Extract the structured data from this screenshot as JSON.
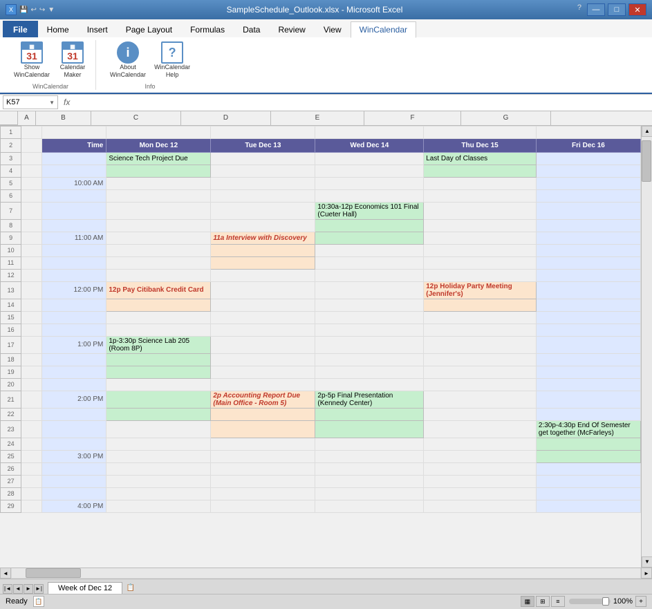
{
  "titlebar": {
    "title": "SampleSchedule_Outlook.xlsx - Microsoft Excel",
    "min_label": "—",
    "max_label": "□",
    "close_label": "✕"
  },
  "ribbon": {
    "tabs": [
      "File",
      "Home",
      "Insert",
      "Page Layout",
      "Formulas",
      "Data",
      "Review",
      "View",
      "WinCalendar"
    ],
    "active_tab": "WinCalendar",
    "groups": {
      "wincalendar": {
        "label": "WinCalendar",
        "items": [
          {
            "id": "show-wincalendar",
            "label": "Show\nWinCalendar"
          },
          {
            "id": "calendar-maker",
            "label": "Calendar\nMaker"
          }
        ]
      },
      "info": {
        "label": "Info",
        "items": [
          {
            "id": "about",
            "label": "About\nWinCalendar"
          },
          {
            "id": "help",
            "label": "WinCalendar\nHelp"
          }
        ]
      }
    }
  },
  "formula_bar": {
    "name_box": "K57",
    "formula": ""
  },
  "column_headers": [
    "A",
    "B",
    "C",
    "D",
    "E",
    "F",
    "G"
  ],
  "row_numbers": [
    1,
    2,
    3,
    4,
    5,
    6,
    7,
    8,
    9,
    10,
    11,
    12,
    13,
    14,
    15,
    16,
    17,
    18,
    19,
    20,
    21,
    22,
    23,
    24,
    25,
    26,
    27,
    28,
    29
  ],
  "calendar": {
    "header_row": {
      "time": "Time",
      "days": [
        "Mon Dec 12",
        "Tue Dec 13",
        "Wed Dec 14",
        "Thu Dec 15",
        "Fri Dec 16"
      ]
    },
    "rows": [
      {
        "row": 1,
        "time": "",
        "cells": [
          "",
          "",
          "",
          "",
          ""
        ]
      },
      {
        "row": 2,
        "is_header": true
      },
      {
        "row": 3,
        "time": "",
        "cells": [
          {
            "text": "Science Tech Project Due",
            "bg": "green"
          },
          "",
          "",
          {
            "text": "Last Day of Classes",
            "bg": "green"
          },
          ""
        ]
      },
      {
        "row": 4,
        "time": "",
        "cells": [
          {
            "merge": true
          },
          "",
          "",
          {
            "merge": true
          },
          ""
        ]
      },
      {
        "row": 5,
        "time": "10:00 AM",
        "cells": [
          "",
          "",
          "",
          "",
          ""
        ]
      },
      {
        "row": 6,
        "time": "",
        "cells": [
          "",
          "",
          "",
          "",
          ""
        ]
      },
      {
        "row": 7,
        "time": "",
        "cells": [
          "",
          "",
          {
            "text": "10:30a-12p Economics 101 Final (Cueter Hall)",
            "bg": "green"
          },
          "",
          ""
        ]
      },
      {
        "row": 8,
        "time": "",
        "cells": [
          "",
          "",
          {
            "merge": true
          },
          "",
          ""
        ]
      },
      {
        "row": 9,
        "time": "11:00 AM",
        "cells": [
          "",
          {
            "text": "11a Interview with Discovery",
            "bg": "orange",
            "style": "bold-italic-red"
          },
          {
            "merge": true
          },
          "",
          ""
        ]
      },
      {
        "row": 10,
        "time": "",
        "cells": [
          "",
          {
            "merge": true
          },
          {
            "merge": true
          },
          "",
          ""
        ]
      },
      {
        "row": 11,
        "time": "",
        "cells": [
          "",
          {
            "merge": true
          },
          "",
          "",
          ""
        ]
      },
      {
        "row": 12,
        "time": "",
        "cells": [
          "",
          "",
          "",
          "",
          ""
        ]
      },
      {
        "row": 13,
        "time": "12:00 PM",
        "cells": [
          {
            "text": "12p Pay Citibank Credit Card",
            "bg": "orange",
            "style": "red-link"
          },
          "",
          "",
          {
            "text": "12p Holiday Party Meeting (Jennifer's)",
            "bg": "orange",
            "style": "red-link"
          },
          ""
        ]
      },
      {
        "row": 14,
        "time": "",
        "cells": [
          {
            "merge": true
          },
          "",
          "",
          {
            "merge": true
          },
          ""
        ]
      },
      {
        "row": 15,
        "time": "",
        "cells": [
          "",
          "",
          "",
          "",
          ""
        ]
      },
      {
        "row": 16,
        "time": "",
        "cells": [
          "",
          "",
          "",
          "",
          ""
        ]
      },
      {
        "row": 17,
        "time": "1:00 PM",
        "cells": [
          {
            "text": "1p-3:30p Science Lab 205 (Room 8P)",
            "bg": "green"
          },
          "",
          "",
          "",
          ""
        ]
      },
      {
        "row": 18,
        "time": "",
        "cells": [
          {
            "merge": true
          },
          "",
          "",
          "",
          ""
        ]
      },
      {
        "row": 19,
        "time": "",
        "cells": [
          {
            "merge": true
          },
          "",
          "",
          "",
          ""
        ]
      },
      {
        "row": 20,
        "time": "",
        "cells": [
          "",
          "",
          "",
          "",
          ""
        ]
      },
      {
        "row": 21,
        "time": "2:00 PM",
        "cells": [
          {
            "merge": true
          },
          {
            "text": "2p Accounting Report Due (Main Office - Room 5)",
            "bg": "orange",
            "style": "bold-italic-red"
          },
          {
            "text": "2p-5p Final Presentation (Kennedy Center)",
            "bg": "green"
          },
          "",
          ""
        ]
      },
      {
        "row": 22,
        "time": "",
        "cells": [
          {
            "merge": true
          },
          {
            "merge": true
          },
          {
            "merge": true
          },
          "",
          ""
        ]
      },
      {
        "row": 23,
        "time": "",
        "cells": [
          "",
          {
            "merge": true
          },
          {
            "merge": true
          },
          "",
          {
            "text": "2:30p-4:30p End Of Semester get together (McFarleys)",
            "bg": "green"
          }
        ]
      },
      {
        "row": 24,
        "time": "",
        "cells": [
          "",
          "",
          "",
          "",
          {
            "merge": true
          }
        ]
      },
      {
        "row": 25,
        "time": "3:00 PM",
        "cells": [
          "",
          "",
          "",
          "",
          {
            "merge": true
          }
        ]
      },
      {
        "row": 26,
        "time": "",
        "cells": [
          "",
          "",
          "",
          "",
          ""
        ]
      },
      {
        "row": 27,
        "time": "",
        "cells": [
          "",
          "",
          "",
          "",
          ""
        ]
      },
      {
        "row": 28,
        "time": "",
        "cells": [
          "",
          "",
          "",
          "",
          ""
        ]
      },
      {
        "row": 29,
        "time": "4:00 PM",
        "cells": [
          "",
          "",
          "",
          "",
          ""
        ]
      }
    ]
  },
  "sheet_tabs": [
    "Week of Dec 12"
  ],
  "status": {
    "ready": "Ready",
    "zoom": "100%"
  }
}
